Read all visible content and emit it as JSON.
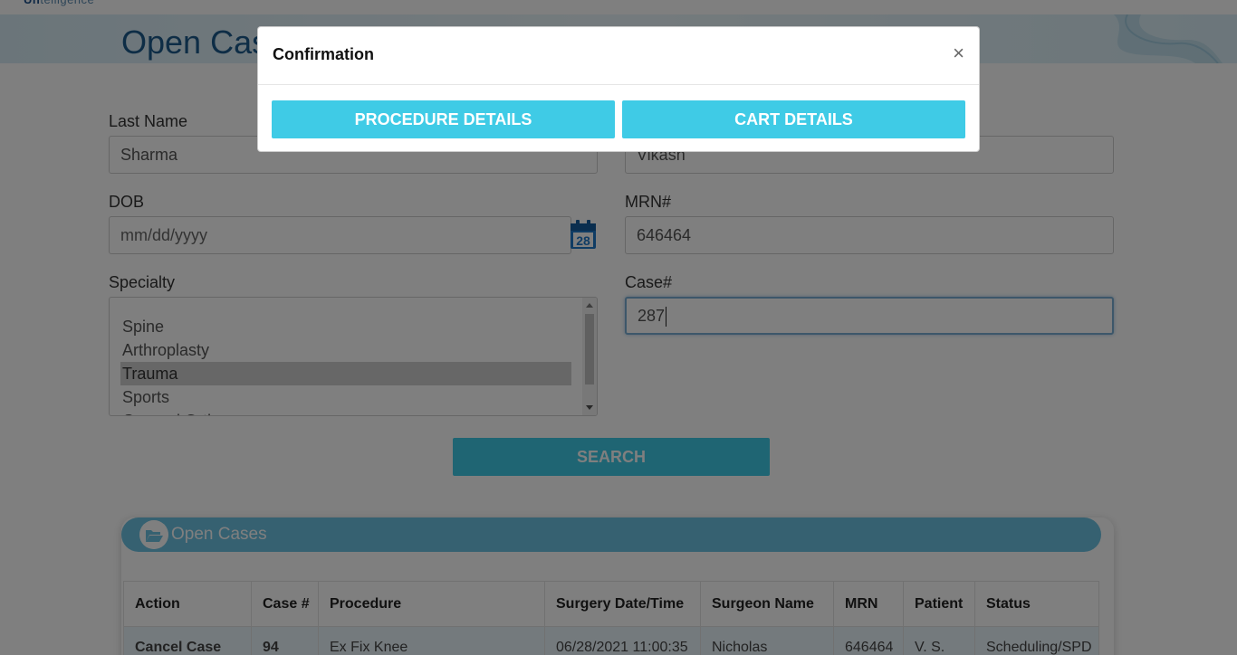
{
  "brand": {
    "prefix": "Un",
    "suffix": "telligence"
  },
  "page": {
    "title": "Open Cases"
  },
  "form": {
    "last_name": {
      "label": "Last Name",
      "value": "Sharma"
    },
    "first_name": {
      "label": "",
      "value": "Vikash"
    },
    "dob": {
      "label": "DOB",
      "placeholder": "mm/dd/yyyy",
      "calendar_day": "28"
    },
    "mrn": {
      "label": "MRN#",
      "value": "646464"
    },
    "specialty": {
      "label": "Specialty",
      "options": [
        "Spine",
        "Arthroplasty",
        "Trauma",
        "Sports",
        "General Ortho"
      ],
      "selected": "Trauma"
    },
    "case": {
      "label": "Case#",
      "value": "287"
    },
    "search_label": "SEARCH"
  },
  "open_cases": {
    "title": "Open Cases",
    "columns": [
      "Action",
      "Case #",
      "Procedure",
      "Surgery Date/Time",
      "Surgeon Name",
      "MRN",
      "Patient",
      "Status"
    ],
    "rows": [
      {
        "action": "Cancel Case",
        "case_no": "94",
        "procedure": "Ex Fix Knee",
        "surgery_datetime": "06/28/2021 11:00:35",
        "surgeon": "Nicholas",
        "mrn": "646464",
        "patient": "V. S.",
        "status": "Scheduling/SPD"
      }
    ]
  },
  "modal": {
    "title": "Confirmation",
    "close_glyph": "×",
    "procedure_details_label": "PROCEDURE DETAILS",
    "cart_details_label": "CART DETAILS"
  },
  "colors": {
    "accent": "#3fcbe6",
    "brand_blue": "#1d5b8c",
    "panel_header": "#6cc2e2",
    "link": "#1b5fa8"
  }
}
